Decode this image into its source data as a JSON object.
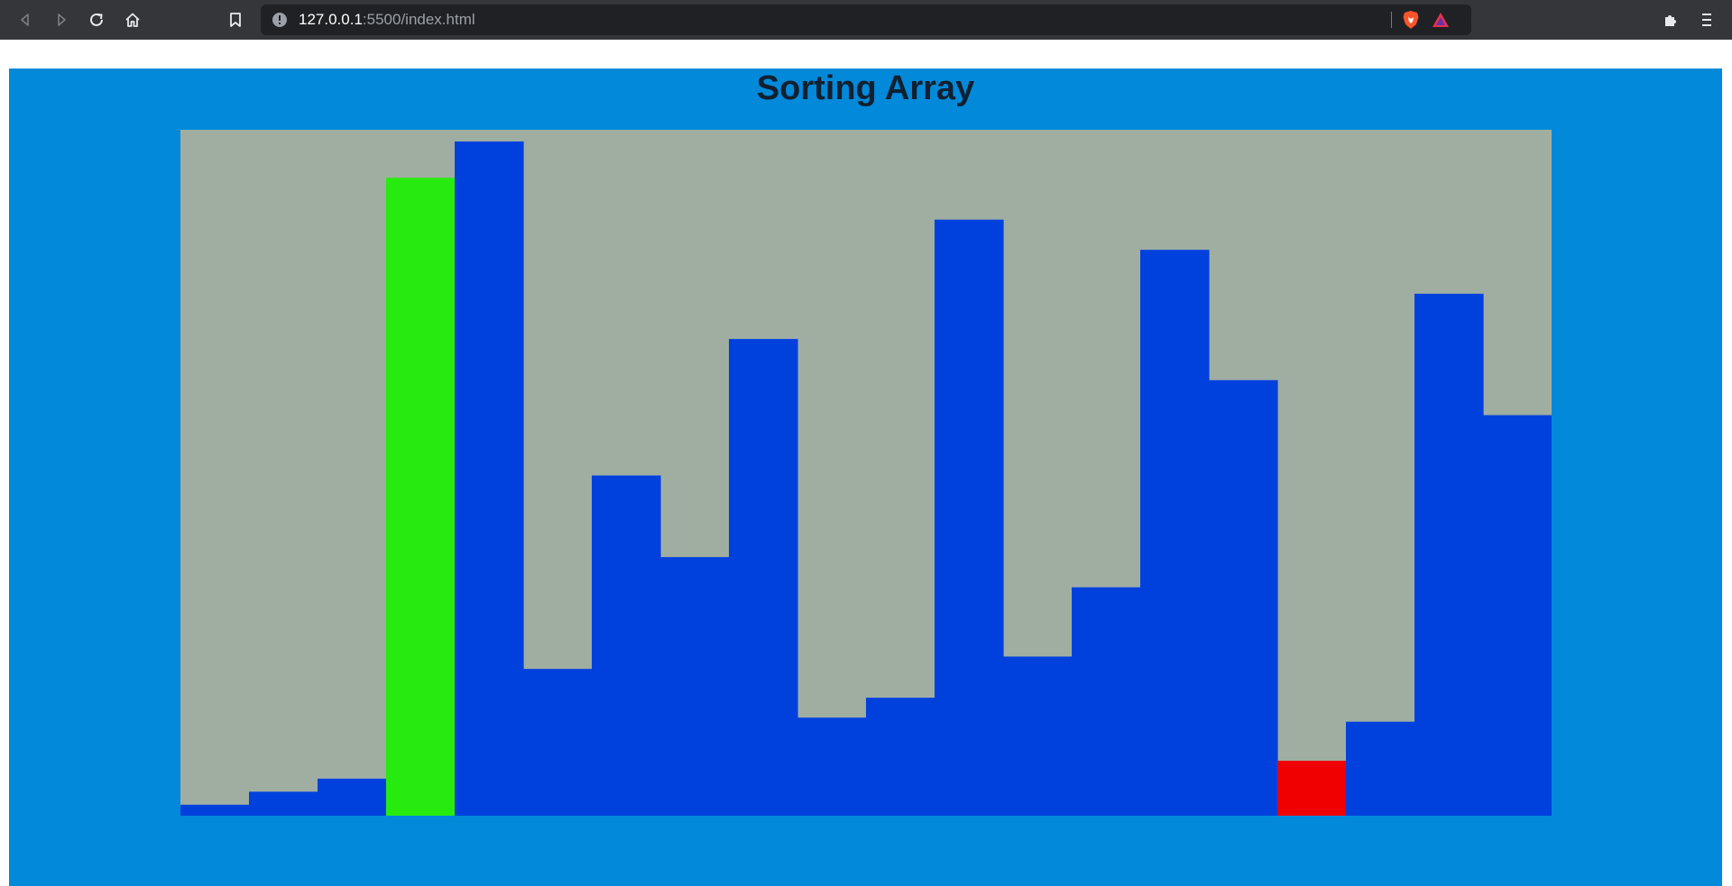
{
  "browser": {
    "url_host": "127.0.0.1",
    "url_path": ":5500/index.html",
    "icons": [
      "back-icon",
      "forward-icon",
      "reload-icon",
      "home-icon",
      "bookmark-icon",
      "info-icon",
      "brave-shield-icon",
      "brave-rewards-icon",
      "extensions-icon",
      "menu-icon"
    ]
  },
  "page": {
    "title": "Sorting Array"
  },
  "colors": {
    "background": "#0289d9",
    "chart_background": "#a0aea2",
    "bar_default": "#0041de",
    "bar_compare": "#27eb0f",
    "bar_swap": "#f00000"
  },
  "chart_data": {
    "type": "bar",
    "title": "",
    "xlabel": "",
    "ylabel": "",
    "ylim": [
      0,
      100
    ],
    "grid": false,
    "legend": "none",
    "values": [
      1.6,
      3.5,
      5.4,
      93,
      98.3,
      21.4,
      49.6,
      37.7,
      69.5,
      14.3,
      17.2,
      86.9,
      23.2,
      33.3,
      82.5,
      63.5,
      8,
      13.7,
      76.1,
      58.4
    ],
    "states": [
      "default",
      "default",
      "default",
      "compare",
      "default",
      "default",
      "default",
      "default",
      "default",
      "default",
      "default",
      "default",
      "default",
      "default",
      "default",
      "default",
      "swap",
      "default",
      "default",
      "default"
    ]
  }
}
